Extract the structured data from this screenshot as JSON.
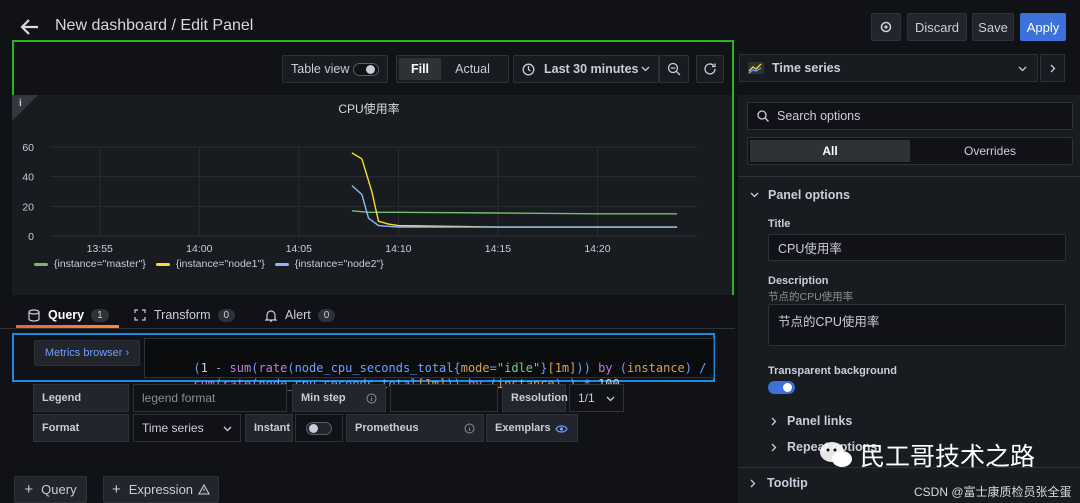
{
  "header": {
    "title": "New dashboard / Edit Panel",
    "discard": "Discard",
    "save": "Save",
    "apply": "Apply"
  },
  "toolbar": {
    "table_view": "Table view",
    "fill": "Fill",
    "actual": "Actual",
    "time_range": "Last 30 minutes"
  },
  "viz_picker": {
    "label": "Time series"
  },
  "chart_data": {
    "type": "line",
    "title": "CPU使用率",
    "info": "i",
    "ylim": [
      0,
      60
    ],
    "yticks": [
      "0",
      "20",
      "40",
      "60"
    ],
    "xticks": [
      "13:55",
      "14:00",
      "14:05",
      "14:10",
      "14:15",
      "14:20"
    ],
    "series": [
      {
        "name": "{instance=\"master\"}",
        "color": "#73bf69",
        "x": [
          "14:07:40",
          "14:08:30",
          "14:10",
          "14:15",
          "14:20",
          "14:24"
        ],
        "values": [
          17,
          16,
          16,
          15.5,
          15,
          15
        ]
      },
      {
        "name": "{instance=\"node1\"}",
        "color": "#fade2a",
        "x": [
          "14:07:40",
          "14:08:10",
          "14:08:40",
          "14:09:00",
          "14:09:30",
          "14:10",
          "14:15",
          "14:20",
          "14:24"
        ],
        "values": [
          56,
          52,
          30,
          10,
          8,
          7,
          6,
          6,
          6
        ]
      },
      {
        "name": "{instance=\"node2\"}",
        "color": "#8ab8ff",
        "x": [
          "14:07:40",
          "14:08:10",
          "14:08:30",
          "14:09:00",
          "14:10",
          "14:15",
          "14:20",
          "14:24"
        ],
        "values": [
          34,
          28,
          12,
          7,
          6,
          6,
          6,
          6
        ]
      }
    ],
    "grid": true,
    "legend": "bottom-left"
  },
  "query_tabs": [
    {
      "label": "Query",
      "count": "1"
    },
    {
      "label": "Transform",
      "count": "0"
    },
    {
      "label": "Alert",
      "count": "0"
    }
  ],
  "query": {
    "metrics_browser": "Metrics browser ›",
    "line1": "(1 - sum(rate(node_cpu_seconds_total{mode=\"idle\"}[1m])) by (instance) /",
    "line2": "sum(rate(node_cpu_seconds_total[1m])) by (instance) ) * 100",
    "legend_label": "Legend",
    "legend_placeholder": "legend format",
    "min_step_label": "Min step",
    "resolution_label": "Resolution",
    "resolution_value": "1/1",
    "format_label": "Format",
    "format_value": "Time series",
    "instant_label": "Instant",
    "prometheus_label": "Prometheus",
    "exemplars_label": "Exemplars"
  },
  "bottom_buttons": {
    "query": "Query",
    "expression": "Expression"
  },
  "options": {
    "search_placeholder": "Search options",
    "all": "All",
    "overrides": "Overrides",
    "panel_options": "Panel options",
    "title_label": "Title",
    "title_value": "CPU使用率",
    "description_label": "Description",
    "description_hint": "节点的CPU使用率",
    "description_value": "节点的CPU使用率",
    "transparent_label": "Transparent background",
    "panel_links": "Panel links",
    "repeat_options": "Repeat options",
    "tooltip": "Tooltip"
  },
  "watermark": {
    "main": "民工哥技术之路",
    "sub": "CSDN @富士康质检员张全蛋"
  }
}
